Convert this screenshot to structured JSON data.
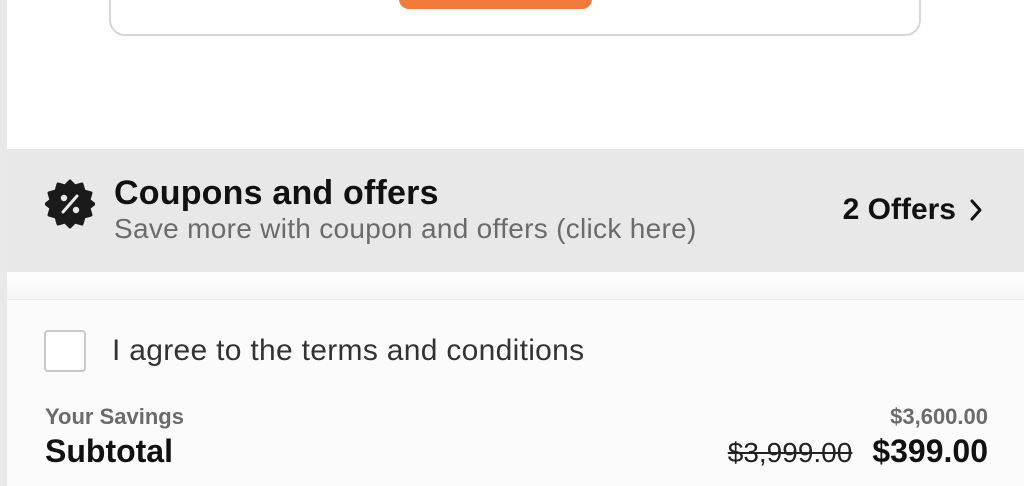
{
  "coupons": {
    "title": "Coupons and offers",
    "subtitle": "Save more with coupon and offers (click here)",
    "offers_label": "2 Offers",
    "icon": "coupon-percent-badge-icon"
  },
  "terms": {
    "label": "I agree to the terms and conditions",
    "checked": false
  },
  "summary": {
    "savings_label": "Your Savings",
    "savings_value": "$3,600.00",
    "subtotal_label": "Subtotal",
    "original_price": "$3,999.00",
    "final_price": "$399.00"
  },
  "colors": {
    "accent": "#ef7a3b",
    "bar_background": "#e8e8e8"
  }
}
